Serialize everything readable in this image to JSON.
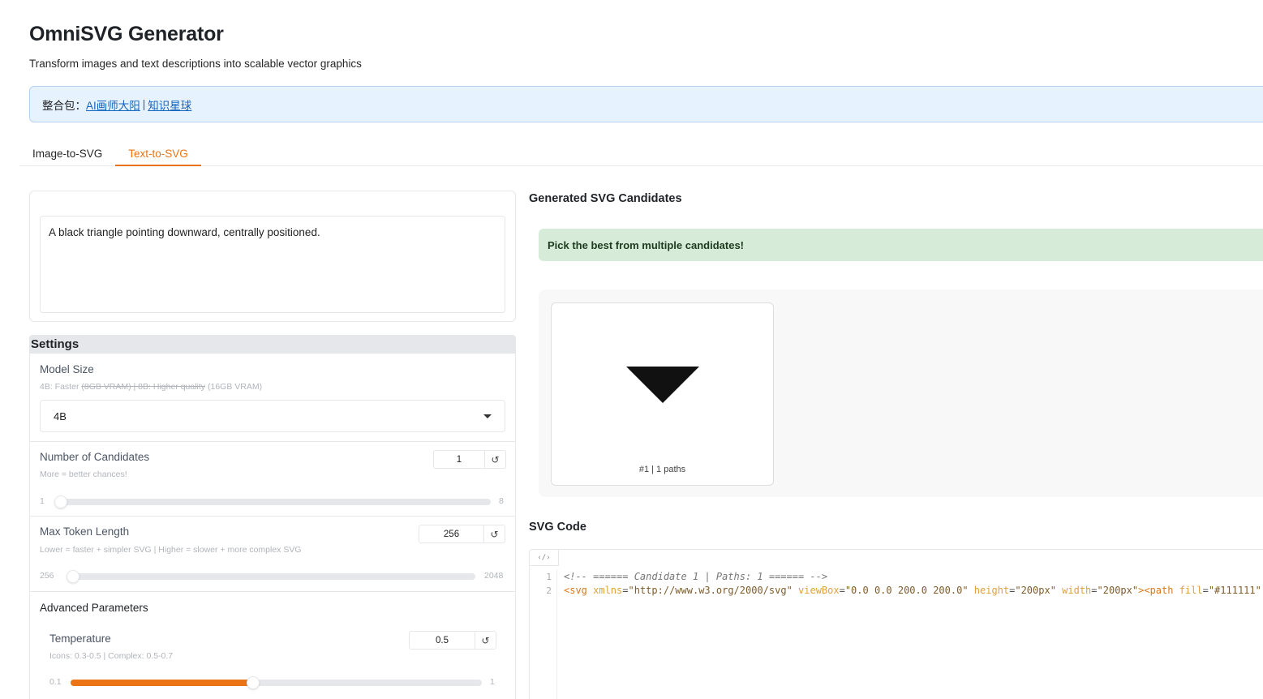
{
  "app": {
    "title": "OmniSVG Generator",
    "subtitle": "Transform images and text descriptions into scalable vector graphics"
  },
  "banner": {
    "prefix": "整合包：",
    "link1": "AI画师大阳",
    "sep": "|",
    "link2": "知识星球"
  },
  "tabs": [
    {
      "label": "Image-to-SVG",
      "active": false
    },
    {
      "label": "Text-to-SVG",
      "active": true
    }
  ],
  "prompt": {
    "value": "A black triangle pointing downward, centrally positioned."
  },
  "settings": {
    "header": "Settings",
    "model_size": {
      "label": "Model Size",
      "info_prefix": "4B: Faster ",
      "info_strike": "(8GB VRAM) | 8B: Higher quality",
      "info_suffix": " (16GB VRAM)",
      "value": "4B"
    },
    "num_candidates": {
      "label": "Number of Candidates",
      "info": "More = better chances!",
      "value": "1",
      "min": "1",
      "max": "8",
      "fraction": 0.0
    },
    "max_token": {
      "label": "Max Token Length",
      "info": "Lower = faster + simpler SVG | Higher = slower + more complex SVG",
      "value": "256",
      "min": "256",
      "max": "2048",
      "fraction": 0.0
    },
    "advanced": {
      "label": "Advanced Parameters",
      "toggle_icon": "▼",
      "temperature": {
        "label": "Temperature",
        "info": "Icons: 0.3-0.5 | Complex: 0.5-0.7",
        "value": "0.5",
        "min": "0.1",
        "max": "1",
        "fraction": 0.444
      }
    },
    "reset_icon": "↺"
  },
  "candidates": {
    "title": "Generated SVG Candidates",
    "note": "Pick the best from multiple candidates!",
    "items": [
      {
        "caption": "#1 | 1 paths",
        "fill": "#111111"
      }
    ]
  },
  "code": {
    "title": "SVG Code",
    "tag": "‹/›",
    "line_numbers": [
      "1",
      "2"
    ],
    "line1": "<!-- ====== Candidate 1 | Paths: 1 ====== -->",
    "l2_open": "<svg",
    "l2_xmlns_attr": " xmlns",
    "l2_xmlns_val": "\"http://www.w3.org/2000/svg\"",
    "l2_viewbox_attr": " viewBox",
    "l2_viewbox_val": "\"0.0 0.0 200.0 200.0\"",
    "l2_height_attr": " height",
    "l2_height_val": "\"200px\"",
    "l2_width_attr": " width",
    "l2_width_val": "\"200px\"",
    "l2_close": ">",
    "l2_path_open": "<path",
    "l2_fill_attr": " fill",
    "l2_fill_val": "\"#111111\""
  },
  "colors": {
    "accent": "#ea7416",
    "banner_bg": "#e6f2fd",
    "note_bg": "#d6ecd9"
  }
}
